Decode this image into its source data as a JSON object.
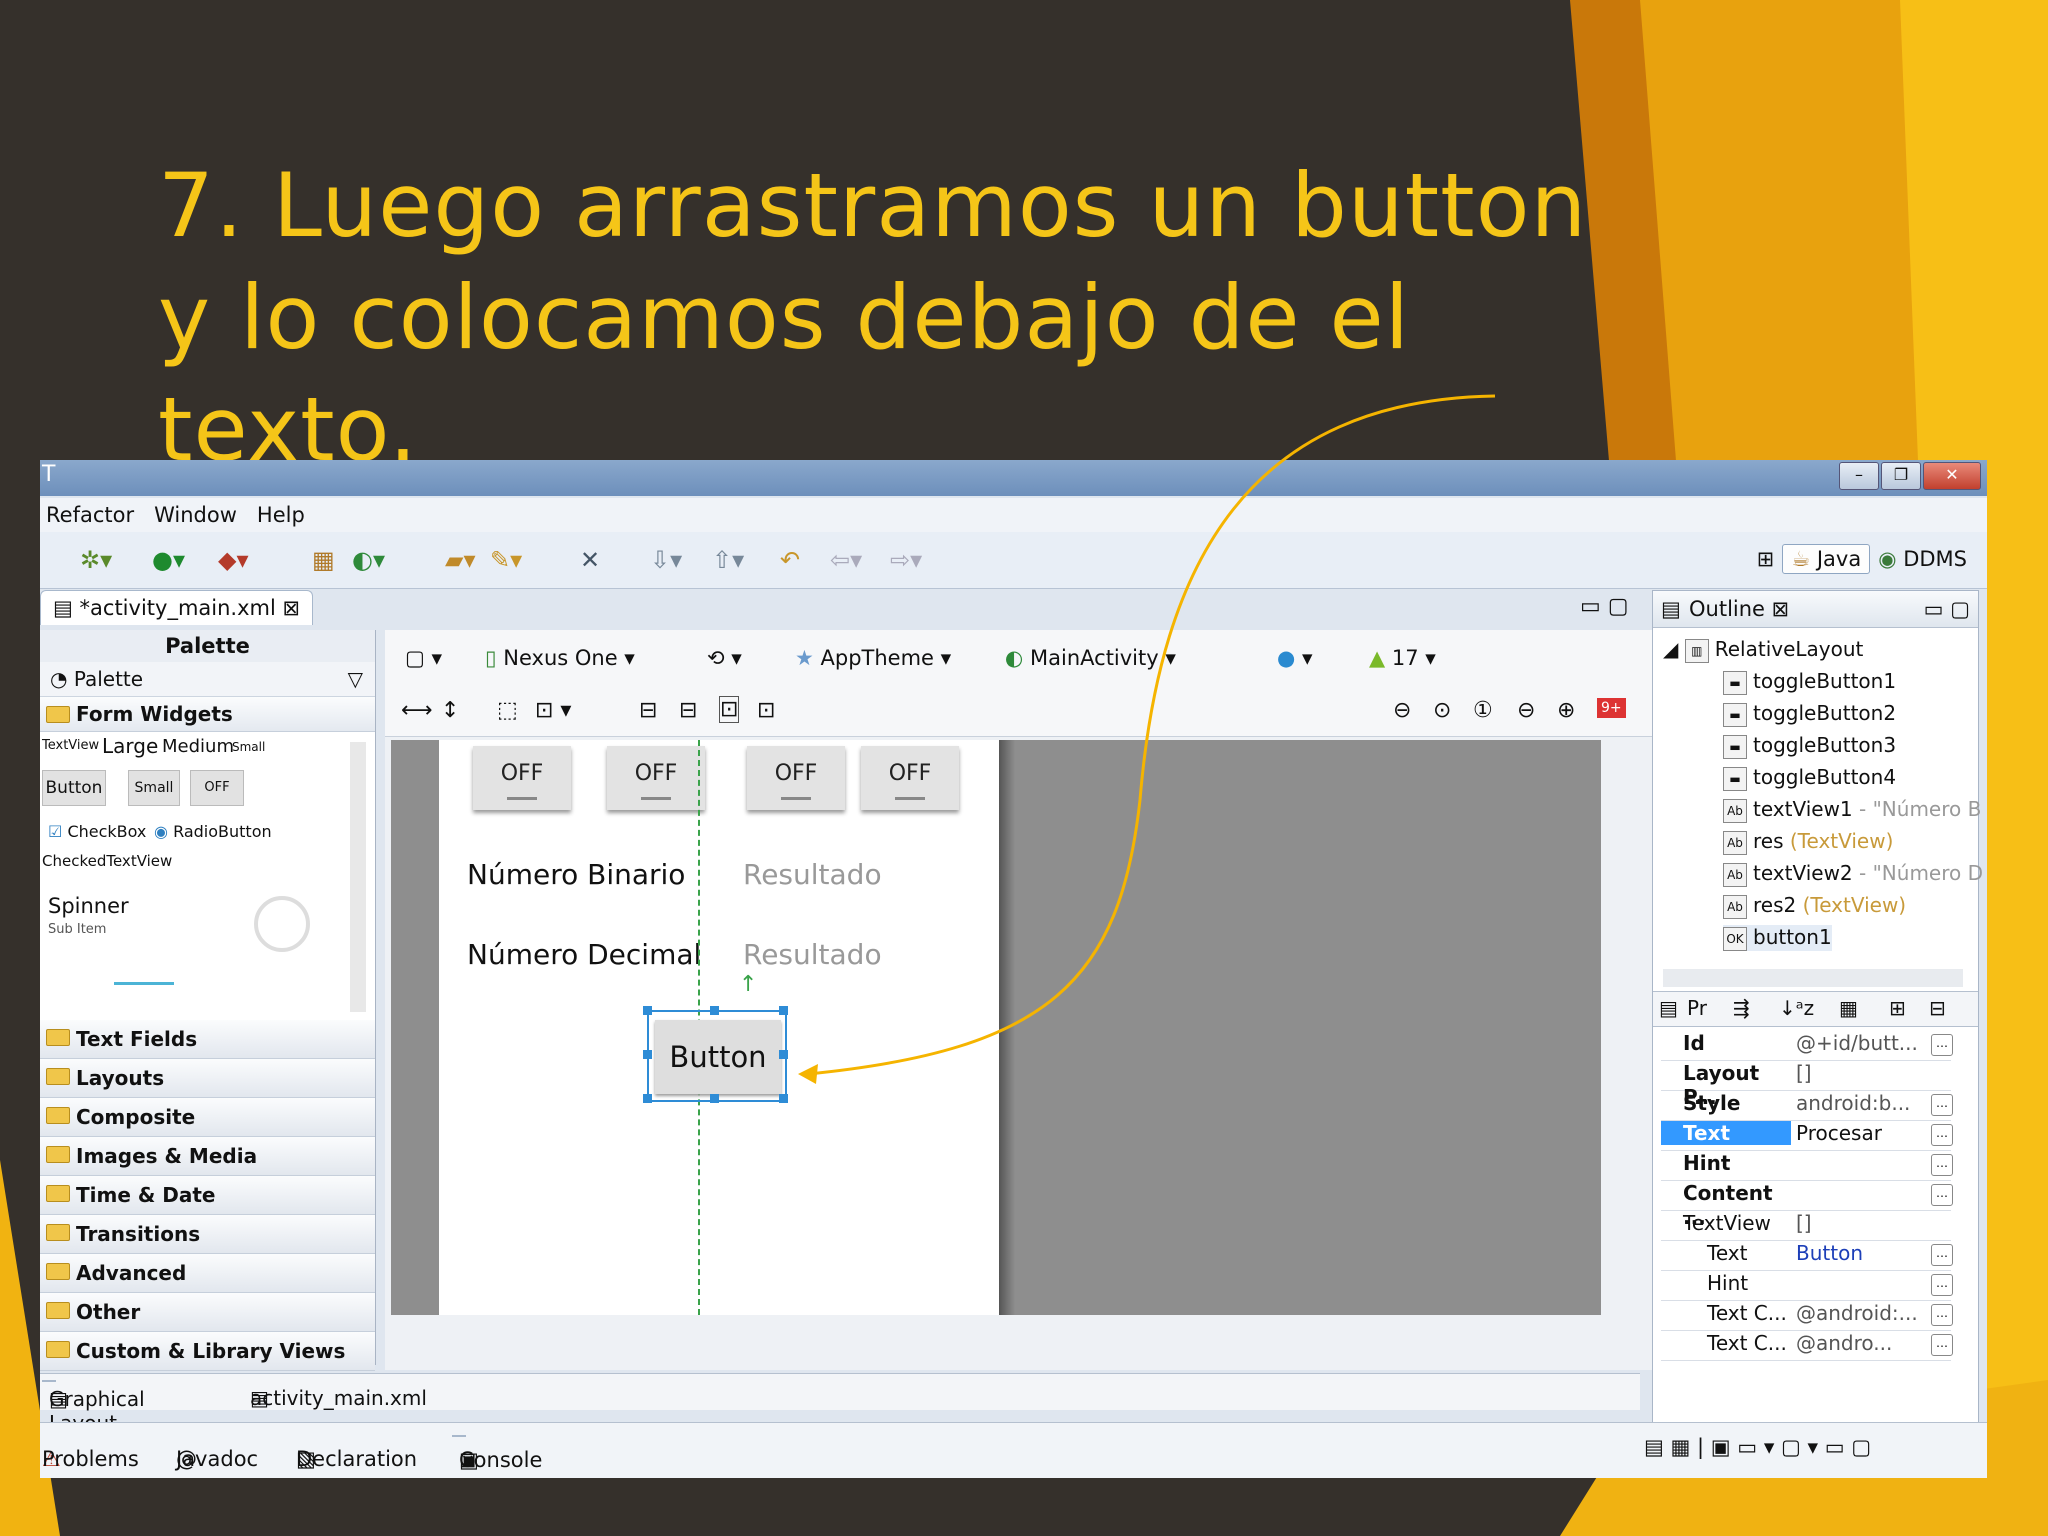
{
  "slide": {
    "title": "7. Luego arrastramos un button y lo colocamos debajo de el texto."
  },
  "window": {
    "title": "T"
  },
  "menu": [
    "Refactor",
    "Window",
    "Help"
  ],
  "perspectives": {
    "java": "Java",
    "ddms": "DDMS"
  },
  "editor_tab": "*activity_main.xml",
  "palette": {
    "header": "Palette",
    "selector": "Palette",
    "form_widgets": "Form Widgets",
    "text_sizes": {
      "small_tv": "TextView",
      "large": "Large",
      "medium": "Medium",
      "small": "Small"
    },
    "buttons": {
      "button": "Button",
      "small": "Small",
      "off": "OFF"
    },
    "checkbox": "CheckBox",
    "radio": "RadioButton",
    "checked_tv": "CheckedTextView",
    "spinner": "Spinner",
    "sub_item": "Sub Item",
    "categories": [
      "Text Fields",
      "Layouts",
      "Composite",
      "Images & Media",
      "Time & Date",
      "Transitions",
      "Advanced",
      "Other",
      "Custom & Library Views"
    ]
  },
  "config": {
    "device": "Nexus One",
    "theme": "AppTheme",
    "activity": "MainActivity",
    "api": "17",
    "errors": "9+"
  },
  "device": {
    "toggles": [
      "OFF",
      "OFF",
      "OFF",
      "OFF"
    ],
    "label_binary": "Número Binario",
    "label_decimal": "Número Decimal",
    "result1": "Resultado",
    "result2": "Resultado",
    "button": "Button"
  },
  "editor_bottom_tabs": {
    "graphical": "Graphical Layout",
    "xml": "activity_main.xml"
  },
  "outline": {
    "title": "Outline",
    "root": "RelativeLayout",
    "items": [
      {
        "name": "toggleButton1",
        "extra": ""
      },
      {
        "name": "toggleButton2",
        "extra": ""
      },
      {
        "name": "toggleButton3",
        "extra": ""
      },
      {
        "name": "toggleButton4",
        "extra": ""
      },
      {
        "name": "textView1",
        "extra": " - \"Número B"
      },
      {
        "name": "res",
        "extra": " (TextView)"
      },
      {
        "name": "textView2",
        "extra": " - \"Número D"
      },
      {
        "name": "res2",
        "extra": " (TextView)"
      },
      {
        "name": "button1",
        "extra": ""
      }
    ]
  },
  "properties": {
    "tab": "Pr",
    "rows": [
      {
        "key": "Id",
        "value": "@+id/butt..."
      },
      {
        "key": "Layout P...",
        "value": "[]"
      },
      {
        "key": "Style",
        "value": "android:b..."
      },
      {
        "key": "Text",
        "value": "Procesar"
      },
      {
        "key": "Hint",
        "value": ""
      },
      {
        "key": "Content ...",
        "value": ""
      },
      {
        "key": "TextView",
        "value": "[]"
      },
      {
        "key": "Text",
        "value": "Button"
      },
      {
        "key": "Hint",
        "value": ""
      },
      {
        "key": "Text C...",
        "value": "@android:..."
      },
      {
        "key": "Text C...",
        "value": "@andro..."
      }
    ]
  },
  "bottom_views": [
    "Problems",
    "Javadoc",
    "Declaration",
    "Console"
  ],
  "colors": {
    "title": "#f5c518",
    "background": "#35302b",
    "accent": "#f5b400",
    "selection": "#2e8cd6"
  }
}
